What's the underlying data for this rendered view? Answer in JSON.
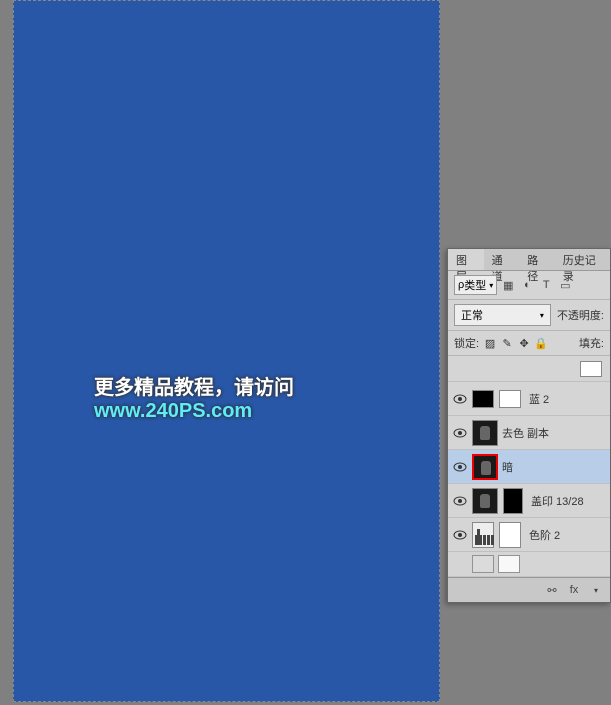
{
  "watermark": {
    "text1": "更多精品教程，请访问 ",
    "text2": "www.240PS.com"
  },
  "panel": {
    "tabs": {
      "layers": "图层",
      "channels": "通道",
      "paths": "路径",
      "history": "历史记录"
    },
    "kind_label": "类型",
    "blend_mode": "正常",
    "opacity_label": "不透明度:",
    "lock_label": "锁定:",
    "fill_label": "填充:",
    "layers": [
      {
        "name": "蓝 2"
      },
      {
        "name": "去色 副本"
      },
      {
        "name": "暗"
      },
      {
        "name": "盖印 13/28"
      },
      {
        "name": "色阶 2"
      },
      {
        "name": ""
      }
    ],
    "footer_fx": "fx"
  }
}
